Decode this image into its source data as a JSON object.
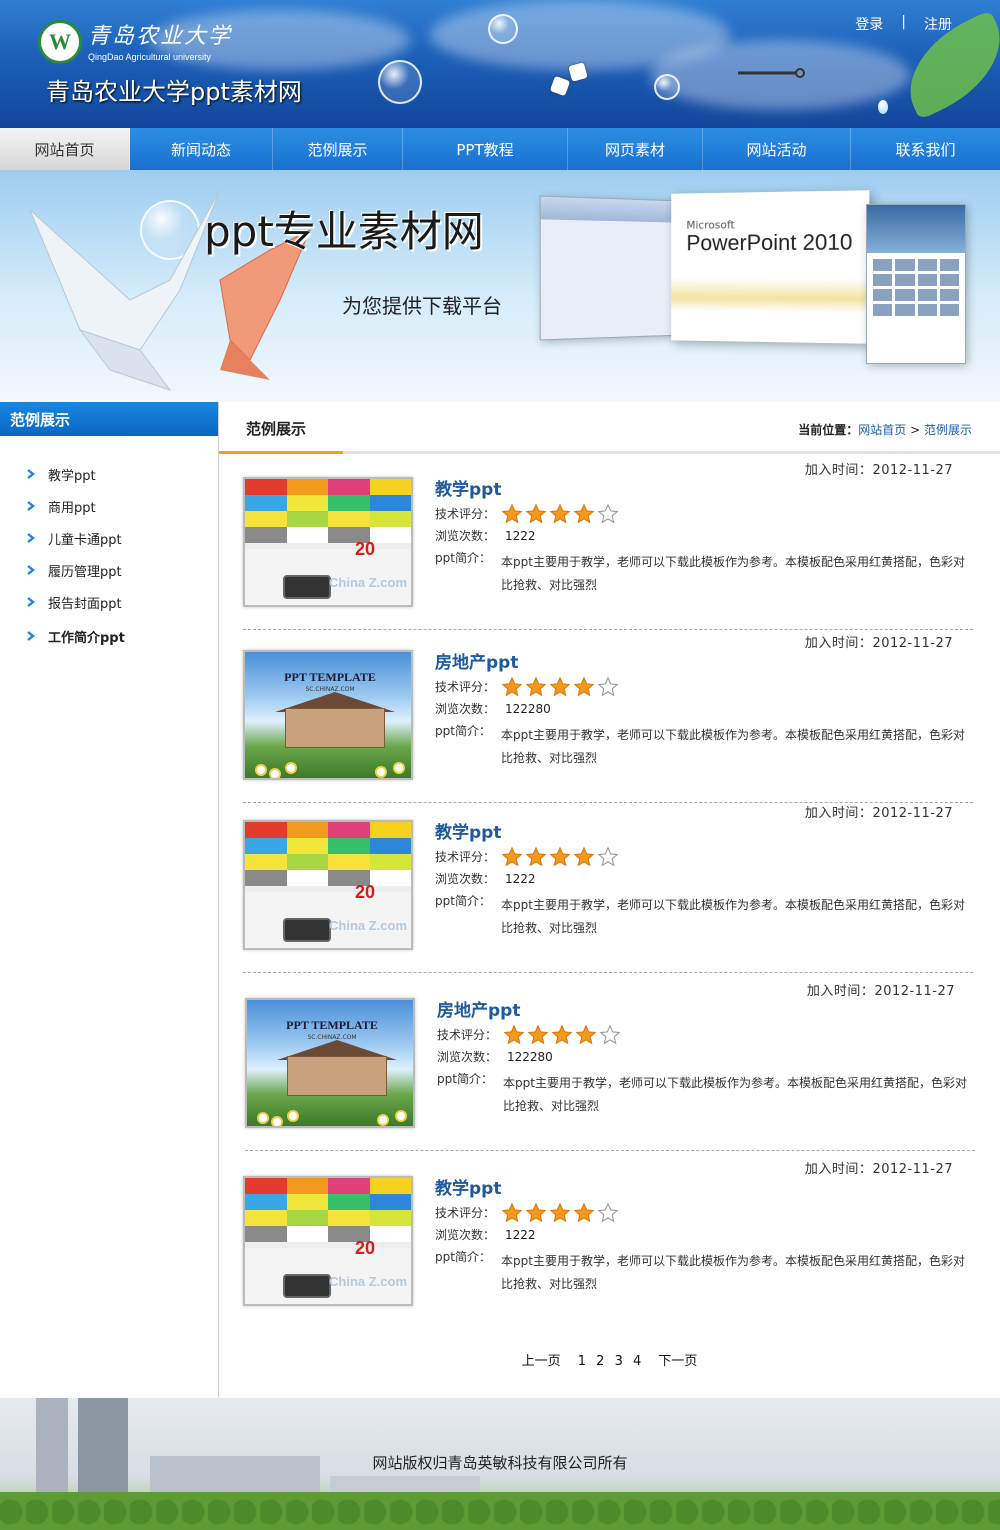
{
  "header": {
    "school_name_cn": "青岛农业大学",
    "school_name_en": "QingDao Agricultural university",
    "site_title": "青岛农业大学ppt素材网",
    "links": {
      "login": "登录",
      "divider": "|",
      "register": "注册"
    }
  },
  "nav": {
    "items": [
      "网站首页",
      "新闻动态",
      "范例展示",
      "PPT教程",
      "网页素材",
      "网站活动",
      "联系我们"
    ],
    "active_index": 0
  },
  "banner": {
    "title": "ppt专业素材网",
    "subtitle": "为您提供下载平台",
    "product_brand": "Microsoft",
    "product_name": "PowerPoint 2010"
  },
  "sidebar": {
    "title": "范例展示",
    "items": [
      "教学ppt",
      "商用ppt",
      "儿童卡通ppt",
      "履历管理ppt",
      "报告封面ppt",
      "工作简介ppt"
    ]
  },
  "main": {
    "title": "范例展示",
    "breadcrumb": {
      "label": "当前位置：",
      "home": "网站首页",
      "sep": ">",
      "current": "范例展示"
    },
    "field_labels": {
      "rating": "技术评分：",
      "views": "浏览次数：",
      "intro": "ppt简介：",
      "date_prefix": "加入时间："
    },
    "entries": [
      {
        "name": "教学ppt",
        "date": "2012-11-27",
        "rating": 4,
        "rating_max": 5,
        "views": "1222",
        "desc": "本ppt主要用于教学，老师可以下载此模板作为参考。本模板配色采用红黄搭配，色彩对比抢救、对比强烈",
        "thumb": "blocks"
      },
      {
        "name": "房地产ppt",
        "date": "2012-11-27",
        "rating": 4,
        "rating_max": 5,
        "views": "122280",
        "desc": "本ppt主要用于教学，老师可以下载此模板作为参考。本模板配色采用红黄搭配，色彩对比抢救、对比强烈",
        "thumb": "house"
      },
      {
        "name": "教学ppt",
        "date": "2012-11-27",
        "rating": 4,
        "rating_max": 5,
        "views": "1222",
        "desc": "本ppt主要用于教学，老师可以下载此模板作为参考。本模板配色采用红黄搭配，色彩对比抢救、对比强烈",
        "thumb": "blocks"
      },
      {
        "name": "房地产ppt",
        "date": "2012-11-27",
        "rating": 4,
        "rating_max": 5,
        "views": "122280",
        "desc": "本ppt主要用于教学，老师可以下载此模板作为参考。本模板配色采用红黄搭配，色彩对比抢救、对比强烈",
        "thumb": "house"
      },
      {
        "name": "教学ppt",
        "date": "2012-11-27",
        "rating": 4,
        "rating_max": 5,
        "views": "1222",
        "desc": "本ppt主要用于教学，老师可以下载此模板作为参考。本模板配色采用红黄搭配，色彩对比抢救、对比强烈",
        "thumb": "blocks"
      }
    ],
    "thumb_text": {
      "blocks_number": "20",
      "blocks_watermark": "China Z.com",
      "house_title": "PPT TEMPLATE",
      "house_sub": "SC.CHINAZ.COM"
    },
    "pager": {
      "prev": "上一页",
      "pages": [
        "1",
        "2",
        "3",
        "4"
      ],
      "next": "下一页"
    }
  },
  "footer": {
    "copyright": "网站版权归青岛英敏科技有限公司所有"
  },
  "colors": {
    "nav_blue": "#1a6fd0",
    "link_blue": "#1f5a9c",
    "star": "#f39a1e",
    "accent_orange": "#f0a020"
  }
}
